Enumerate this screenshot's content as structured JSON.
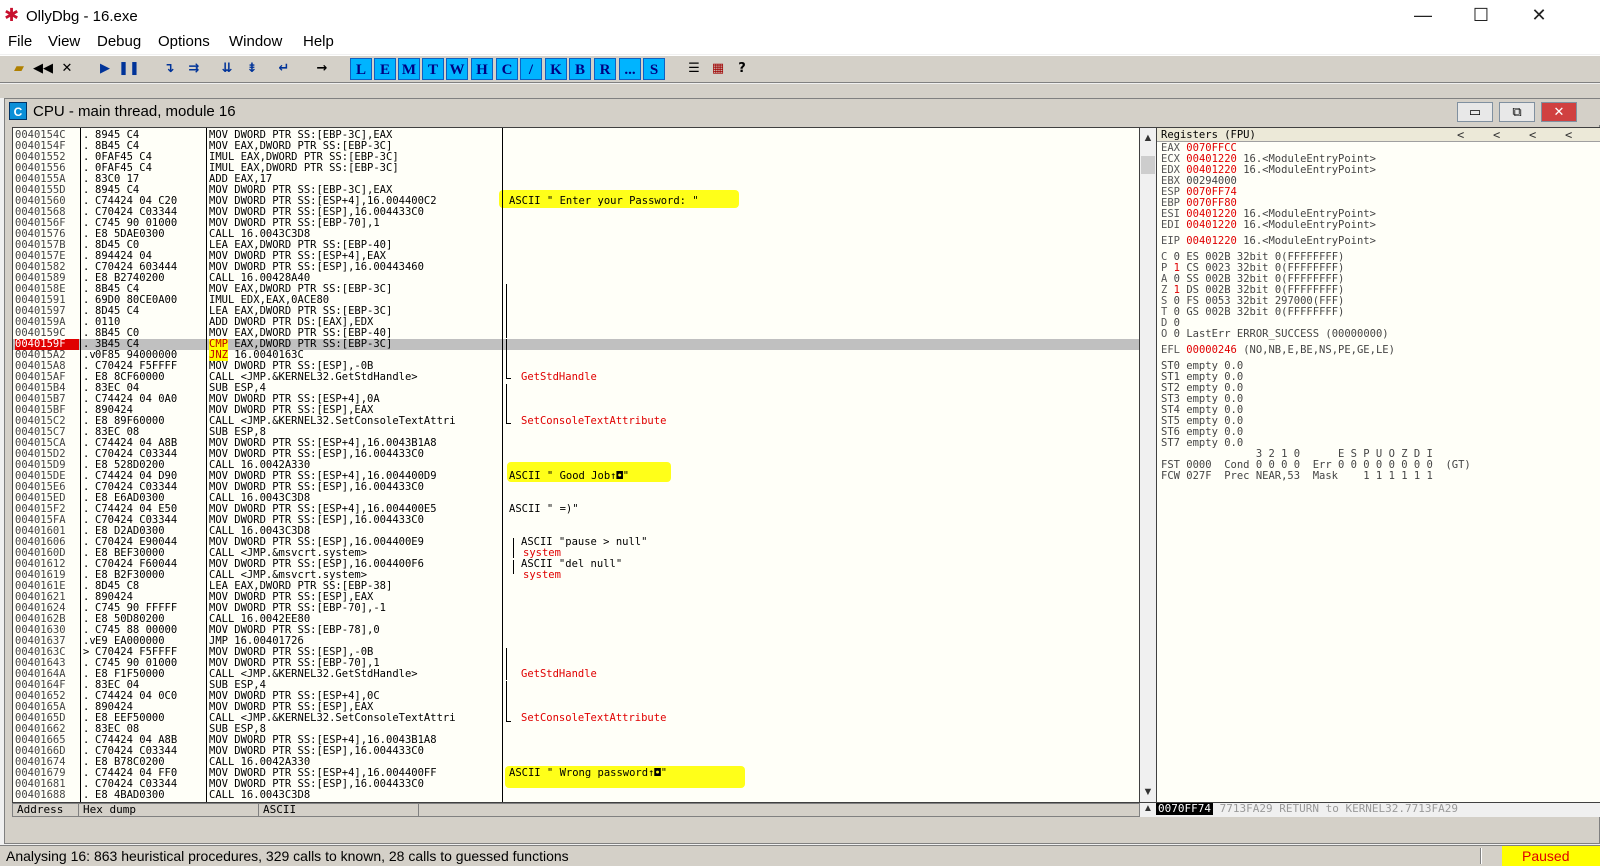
{
  "window": {
    "title": "OllyDbg - 16.exe",
    "icon": "ollydbg-bug-icon",
    "controls": {
      "minimize": "—",
      "maximize": "☐",
      "close": "✕"
    }
  },
  "menu": [
    "File",
    "View",
    "Debug",
    "Options",
    "Window",
    "Help"
  ],
  "toolbar": {
    "icons": [
      "open-icon",
      "rewind-icon",
      "close-icon",
      "run-icon",
      "pause-icon",
      "step-into-icon",
      "step-over-icon",
      "trace-into-icon",
      "trace-over-icon",
      "execute-till-return-icon",
      "goto-icon"
    ],
    "letters": [
      "L",
      "E",
      "M",
      "T",
      "W",
      "H",
      "C",
      "/",
      "K",
      "B",
      "R",
      "...",
      "S"
    ],
    "end_icons": [
      "list-icon",
      "grid-icon",
      "help-icon"
    ],
    "end_glyphs": [
      "☰",
      "▦",
      "?"
    ]
  },
  "cpu_window": {
    "title": "CPU - main thread, module 16",
    "icon_letter": "C",
    "buttons": [
      "▭",
      "⧉",
      "✕"
    ]
  },
  "disasm": [
    {
      "addr": "0040154C",
      "mark": ".",
      "hex": "8945 C4",
      "instr": "MOV DWORD PTR SS:[EBP-3C],EAX",
      "comment": ""
    },
    {
      "addr": "0040154F",
      "mark": ".",
      "hex": "8B45 C4",
      "instr": "MOV EAX,DWORD PTR SS:[EBP-3C]",
      "comment": ""
    },
    {
      "addr": "00401552",
      "mark": ".",
      "hex": "0FAF45 C4",
      "instr": "IMUL EAX,DWORD PTR SS:[EBP-3C]",
      "comment": ""
    },
    {
      "addr": "00401556",
      "mark": ".",
      "hex": "0FAF45 C4",
      "instr": "IMUL EAX,DWORD PTR SS:[EBP-3C]",
      "comment": ""
    },
    {
      "addr": "0040155A",
      "mark": ".",
      "hex": "83C0 17",
      "instr": "ADD EAX,17",
      "comment": ""
    },
    {
      "addr": "0040155D",
      "mark": ".",
      "hex": "8945 C4",
      "instr": "MOV DWORD PTR SS:[EBP-3C],EAX",
      "comment": ""
    },
    {
      "addr": "00401560",
      "mark": ".",
      "hex": "C74424 04 C20",
      "instr": "MOV DWORD PTR SS:[ESP+4],16.004400C2",
      "comment": "ASCII \" Enter your Password: \""
    },
    {
      "addr": "00401568",
      "mark": ".",
      "hex": "C70424 C03344",
      "instr": "MOV DWORD PTR SS:[ESP],16.004433C0",
      "comment": ""
    },
    {
      "addr": "0040156F",
      "mark": ".",
      "hex": "C745 90 01000",
      "instr": "MOV DWORD PTR SS:[EBP-70],1",
      "comment": ""
    },
    {
      "addr": "00401576",
      "mark": ".",
      "hex": "E8 5DAE0300",
      "instr": "CALL 16.0043C3D8",
      "comment": ""
    },
    {
      "addr": "0040157B",
      "mark": ".",
      "hex": "8D45 C0",
      "instr": "LEA EAX,DWORD PTR SS:[EBP-40]",
      "comment": ""
    },
    {
      "addr": "0040157E",
      "mark": ".",
      "hex": "894424 04",
      "instr": "MOV DWORD PTR SS:[ESP+4],EAX",
      "comment": ""
    },
    {
      "addr": "00401582",
      "mark": ".",
      "hex": "C70424 603444",
      "instr": "MOV DWORD PTR SS:[ESP],16.00443460",
      "comment": ""
    },
    {
      "addr": "00401589",
      "mark": ".",
      "hex": "E8 B2740200",
      "instr": "CALL 16.00428A40",
      "comment": ""
    },
    {
      "addr": "0040158E",
      "mark": ".",
      "hex": "8B45 C4",
      "instr": "MOV EAX,DWORD PTR SS:[EBP-3C]",
      "comment": ""
    },
    {
      "addr": "00401591",
      "mark": ".",
      "hex": "69D0 80CE0A00",
      "instr": "IMUL EDX,EAX,0ACE80",
      "comment": ""
    },
    {
      "addr": "00401597",
      "mark": ".",
      "hex": "8D45 C4",
      "instr": "LEA EAX,DWORD PTR SS:[EBP-3C]",
      "comment": ""
    },
    {
      "addr": "0040159A",
      "mark": ".",
      "hex": "0110",
      "instr": "ADD DWORD PTR DS:[EAX],EDX",
      "comment": ""
    },
    {
      "addr": "0040159C",
      "mark": ".",
      "hex": "8B45 C0",
      "instr": "MOV EAX,DWORD PTR SS:[EBP-40]",
      "comment": ""
    },
    {
      "addr": "0040159F",
      "mark": ".",
      "hex": "3B45 C4",
      "instr": "CMP EAX,DWORD PTR SS:[EBP-3C]",
      "comment": ""
    },
    {
      "addr": "004015A2",
      "mark": ".v",
      "hex": "0F85 94000000",
      "instr": "JNZ 16.0040163C",
      "comment": ""
    },
    {
      "addr": "004015A8",
      "mark": ".",
      "hex": "C70424 F5FFFF",
      "instr": "MOV DWORD PTR SS:[ESP],-0B",
      "comment": ""
    },
    {
      "addr": "004015AF",
      "mark": ".",
      "hex": "E8 8CF60000",
      "instr": "CALL <JMP.&KERNEL32.GetStdHandle>",
      "comment": "GetStdHandle"
    },
    {
      "addr": "004015B4",
      "mark": ".",
      "hex": "83EC 04",
      "instr": "SUB ESP,4",
      "comment": ""
    },
    {
      "addr": "004015B7",
      "mark": ".",
      "hex": "C74424 04 0A0",
      "instr": "MOV DWORD PTR SS:[ESP+4],0A",
      "comment": ""
    },
    {
      "addr": "004015BF",
      "mark": ".",
      "hex": "890424",
      "instr": "MOV DWORD PTR SS:[ESP],EAX",
      "comment": ""
    },
    {
      "addr": "004015C2",
      "mark": ".",
      "hex": "E8 89F60000",
      "instr": "CALL <JMP.&KERNEL32.SetConsoleTextAttri",
      "comment": "SetConsoleTextAttribute"
    },
    {
      "addr": "004015C7",
      "mark": ".",
      "hex": "83EC 08",
      "instr": "SUB ESP,8",
      "comment": ""
    },
    {
      "addr": "004015CA",
      "mark": ".",
      "hex": "C74424 04 A8B",
      "instr": "MOV DWORD PTR SS:[ESP+4],16.0043B1A8",
      "comment": ""
    },
    {
      "addr": "004015D2",
      "mark": ".",
      "hex": "C70424 C03344",
      "instr": "MOV DWORD PTR SS:[ESP],16.004433C0",
      "comment": ""
    },
    {
      "addr": "004015D9",
      "mark": ".",
      "hex": "E8 528D0200",
      "instr": "CALL 16.0042A330",
      "comment": ""
    },
    {
      "addr": "004015DE",
      "mark": ".",
      "hex": "C74424 04 D90",
      "instr": "MOV DWORD PTR SS:[ESP+4],16.004400D9",
      "comment": "ASCII \" Good Job↑◘\""
    },
    {
      "addr": "004015E6",
      "mark": ".",
      "hex": "C70424 C03344",
      "instr": "MOV DWORD PTR SS:[ESP],16.004433C0",
      "comment": ""
    },
    {
      "addr": "004015ED",
      "mark": ".",
      "hex": "E8 E6AD0300",
      "instr": "CALL 16.0043C3D8",
      "comment": ""
    },
    {
      "addr": "004015F2",
      "mark": ".",
      "hex": "C74424 04 E50",
      "instr": "MOV DWORD PTR SS:[ESP+4],16.004400E5",
      "comment": "ASCII \" =)\""
    },
    {
      "addr": "004015FA",
      "mark": ".",
      "hex": "C70424 C03344",
      "instr": "MOV DWORD PTR SS:[ESP],16.004433C0",
      "comment": ""
    },
    {
      "addr": "00401601",
      "mark": ".",
      "hex": "E8 D2AD0300",
      "instr": "CALL 16.0043C3D8",
      "comment": ""
    },
    {
      "addr": "00401606",
      "mark": ".",
      "hex": "C70424 E90044",
      "instr": "MOV DWORD PTR SS:[ESP],16.004400E9",
      "comment": "ASCII \"pause > null\""
    },
    {
      "addr": "0040160D",
      "mark": ".",
      "hex": "E8 BEF30000",
      "instr": "CALL <JMP.&msvcrt.system>",
      "comment": "system"
    },
    {
      "addr": "00401612",
      "mark": ".",
      "hex": "C70424 F60044",
      "instr": "MOV DWORD PTR SS:[ESP],16.004400F6",
      "comment": "ASCII \"del null\""
    },
    {
      "addr": "00401619",
      "mark": ".",
      "hex": "E8 B2F30000",
      "instr": "CALL <JMP.&msvcrt.system>",
      "comment": "system"
    },
    {
      "addr": "0040161E",
      "mark": ".",
      "hex": "8D45 C8",
      "instr": "LEA EAX,DWORD PTR SS:[EBP-38]",
      "comment": ""
    },
    {
      "addr": "00401621",
      "mark": ".",
      "hex": "890424",
      "instr": "MOV DWORD PTR SS:[ESP],EAX",
      "comment": ""
    },
    {
      "addr": "00401624",
      "mark": ".",
      "hex": "C745 90 FFFFF",
      "instr": "MOV DWORD PTR SS:[EBP-70],-1",
      "comment": ""
    },
    {
      "addr": "0040162B",
      "mark": ".",
      "hex": "E8 50D80200",
      "instr": "CALL 16.0042EE80",
      "comment": ""
    },
    {
      "addr": "00401630",
      "mark": ".",
      "hex": "C745 88 00000",
      "instr": "MOV DWORD PTR SS:[EBP-78],0",
      "comment": ""
    },
    {
      "addr": "00401637",
      "mark": ".v",
      "hex": "E9 EA000000",
      "instr": "JMP 16.00401726",
      "comment": ""
    },
    {
      "addr": "0040163C",
      "mark": ">",
      "hex": "C70424 F5FFFF",
      "instr": "MOV DWORD PTR SS:[ESP],-0B",
      "comment": ""
    },
    {
      "addr": "00401643",
      "mark": ".",
      "hex": "C745 90 01000",
      "instr": "MOV DWORD PTR SS:[EBP-70],1",
      "comment": ""
    },
    {
      "addr": "0040164A",
      "mark": ".",
      "hex": "E8 F1F50000",
      "instr": "CALL <JMP.&KERNEL32.GetStdHandle>",
      "comment": "GetStdHandle"
    },
    {
      "addr": "0040164F",
      "mark": ".",
      "hex": "83EC 04",
      "instr": "SUB ESP,4",
      "comment": ""
    },
    {
      "addr": "00401652",
      "mark": ".",
      "hex": "C74424 04 0C0",
      "instr": "MOV DWORD PTR SS:[ESP+4],0C",
      "comment": ""
    },
    {
      "addr": "0040165A",
      "mark": ".",
      "hex": "890424",
      "instr": "MOV DWORD PTR SS:[ESP],EAX",
      "comment": ""
    },
    {
      "addr": "0040165D",
      "mark": ".",
      "hex": "E8 EEF50000",
      "instr": "CALL <JMP.&KERNEL32.SetConsoleTextAttri",
      "comment": "SetConsoleTextAttribute"
    },
    {
      "addr": "00401662",
      "mark": ".",
      "hex": "83EC 08",
      "instr": "SUB ESP,8",
      "comment": ""
    },
    {
      "addr": "00401665",
      "mark": ".",
      "hex": "C74424 04 A8B",
      "instr": "MOV DWORD PTR SS:[ESP+4],16.0043B1A8",
      "comment": ""
    },
    {
      "addr": "0040166D",
      "mark": ".",
      "hex": "C70424 C03344",
      "instr": "MOV DWORD PTR SS:[ESP],16.004433C0",
      "comment": ""
    },
    {
      "addr": "00401674",
      "mark": ".",
      "hex": "E8 B78C0200",
      "instr": "CALL 16.0042A330",
      "comment": ""
    },
    {
      "addr": "00401679",
      "mark": ".",
      "hex": "C74424 04 FF0",
      "instr": "MOV DWORD PTR SS:[ESP+4],16.004400FF",
      "comment": "ASCII \" Wrong password↑◘\""
    },
    {
      "addr": "00401681",
      "mark": ".",
      "hex": "C70424 C03344",
      "instr": "MOV DWORD PTR SS:[ESP],16.004433C0",
      "comment": ""
    },
    {
      "addr": "00401688",
      "mark": ".",
      "hex": "E8 4BAD0300",
      "instr": "CALL 16.0043C3D8",
      "comment": ""
    }
  ],
  "registers": {
    "title": "Registers (FPU)",
    "arrows": [
      "<",
      "<",
      "<",
      "<"
    ],
    "general": [
      {
        "name": "EAX",
        "value": "0070FFCC",
        "note": ""
      },
      {
        "name": "ECX",
        "value": "00401220",
        "note": "16.<ModuleEntryPoint>"
      },
      {
        "name": "EDX",
        "value": "00401220",
        "note": "16.<ModuleEntryPoint>"
      },
      {
        "name": "EBX",
        "value": "00294000",
        "note": ""
      },
      {
        "name": "ESP",
        "value": "0070FF74",
        "note": ""
      },
      {
        "name": "EBP",
        "value": "0070FF80",
        "note": ""
      },
      {
        "name": "ESI",
        "value": "00401220",
        "note": "16.<ModuleEntryPoint>"
      },
      {
        "name": "EDI",
        "value": "00401220",
        "note": "16.<ModuleEntryPoint>"
      }
    ],
    "eip": {
      "name": "EIP",
      "value": "00401220",
      "note": "16.<ModuleEntryPoint>"
    },
    "flags": [
      {
        "flag": "C",
        "val": "0",
        "seg": "ES 002B 32bit 0(FFFFFFFF)"
      },
      {
        "flag": "P",
        "val": "1",
        "seg": "CS 0023 32bit 0(FFFFFFFF)"
      },
      {
        "flag": "A",
        "val": "0",
        "seg": "SS 002B 32bit 0(FFFFFFFF)"
      },
      {
        "flag": "Z",
        "val": "1",
        "seg": "DS 002B 32bit 0(FFFFFFFF)"
      },
      {
        "flag": "S",
        "val": "0",
        "seg": "FS 0053 32bit 297000(FFF)"
      },
      {
        "flag": "T",
        "val": "0",
        "seg": "GS 002B 32bit 0(FFFFFFFF)"
      },
      {
        "flag": "D",
        "val": "0",
        "seg": ""
      },
      {
        "flag": "O",
        "val": "0",
        "seg": "LastErr ERROR_SUCCESS (00000000)"
      }
    ],
    "efl": {
      "name": "EFL",
      "value": "00000246",
      "note": "(NO,NB,E,BE,NS,PE,GE,LE)"
    },
    "fpu": [
      "ST0 empty 0.0",
      "ST1 empty 0.0",
      "ST2 empty 0.0",
      "ST3 empty 0.0",
      "ST4 empty 0.0",
      "ST5 empty 0.0",
      "ST6 empty 0.0",
      "ST7 empty 0.0"
    ],
    "fpu_header": "               3 2 1 0      E S P U O Z D I",
    "fst": "FST 0000  Cond 0 0 0 0  Err 0 0 0 0 0 0 0 0  (GT)",
    "fcw": "FCW 027F  Prec NEAR,53  Mask    1 1 1 1 1 1"
  },
  "dump_header": [
    "Address",
    "Hex dump",
    "ASCII"
  ],
  "stack_line": {
    "addr": "0070FF74",
    "value": "7713FA29",
    "comment": "RETURN to KERNEL32.7713FA29"
  },
  "status": {
    "message": "Analysing 16: 863 heuristical procedures, 329 calls to known, 28 calls to guessed functions",
    "state": "Paused"
  },
  "colors": {
    "highlight": "#ffff00",
    "selected_addr_bg": "#e00000",
    "api_comment": "#e00000",
    "toolbar_letter": "#00b4ff"
  }
}
